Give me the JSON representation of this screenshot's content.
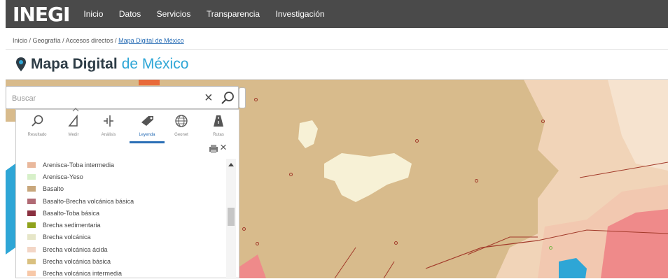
{
  "header": {
    "logo": "INEGI",
    "nav": [
      "Inicio",
      "Datos",
      "Servicios",
      "Transparencia",
      "Investigación"
    ]
  },
  "breadcrumb": {
    "items": [
      "Inicio",
      "Geografía",
      "Accesos directos"
    ],
    "current": "Mapa Digital de México",
    "separator": " / "
  },
  "title": {
    "main": "Mapa Digital",
    "sub": "de México"
  },
  "search": {
    "placeholder": "Buscar",
    "value": ""
  },
  "tools": [
    {
      "label": "Resultado",
      "icon": "magnifier-icon"
    },
    {
      "label": "Medir",
      "icon": "ruler-triangle-icon"
    },
    {
      "label": "Análisis",
      "icon": "analysis-icon"
    },
    {
      "label": "Leyenda",
      "icon": "tag-icon",
      "active": true
    },
    {
      "label": "Geonet",
      "icon": "globe-icon"
    },
    {
      "label": "Rutas",
      "icon": "road-icon"
    }
  ],
  "legend": [
    {
      "label": "Arenisca-Toba intermedia",
      "color": "#e9b89c"
    },
    {
      "label": "Arenisca-Yeso",
      "color": "#d7f0c9"
    },
    {
      "label": "Basalto",
      "color": "#c8a77c"
    },
    {
      "label": "Basalto-Brecha volcánica básica",
      "color": "#b06a74"
    },
    {
      "label": "Basalto-Toba básica",
      "color": "#8a3140"
    },
    {
      "label": "Brecha sedimentaria",
      "color": "#8fa21c"
    },
    {
      "label": "Brecha volcánica",
      "color": "#e6e6c8"
    },
    {
      "label": "Brecha volcánica ácida",
      "color": "#f3d6c6"
    },
    {
      "label": "Brecha volcánica básica",
      "color": "#d9c080"
    },
    {
      "label": "Brecha volcánica intermedia",
      "color": "#f7c8a8"
    }
  ],
  "colors": {
    "header": "#4a4a4a",
    "accent": "#2ea6d6",
    "map_base": "#d8bb8c"
  }
}
